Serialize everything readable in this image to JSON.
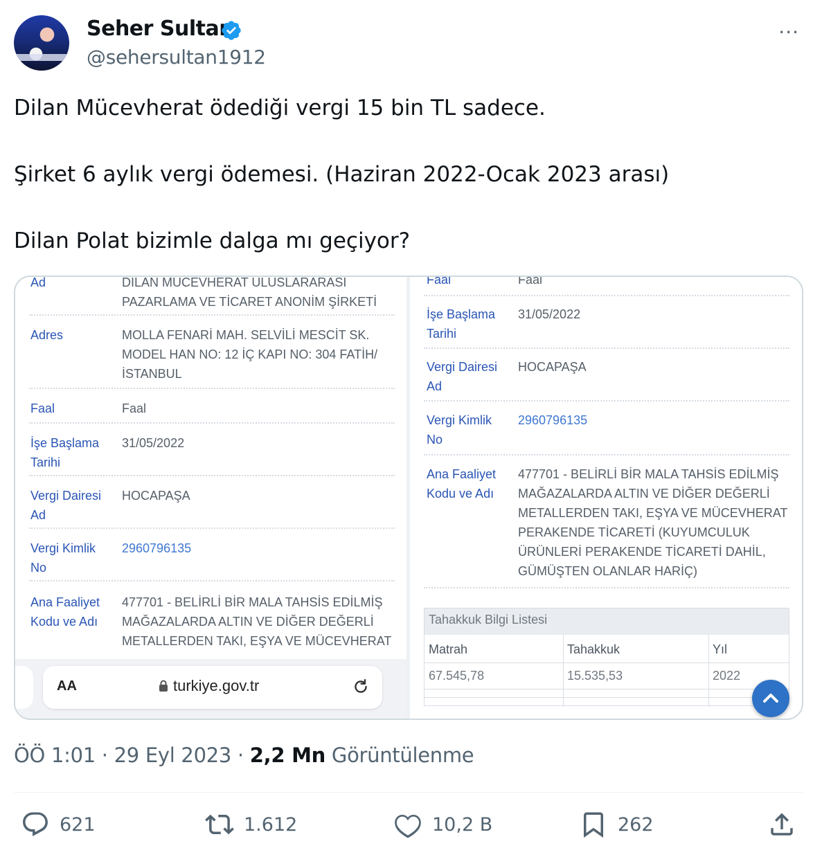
{
  "author": {
    "name": "Seher Sultan",
    "handle": "@sehersultan1912",
    "verified_icon": "verified-badge-icon"
  },
  "more_label": "···",
  "tweet": {
    "lines": [
      "Dilan Mücevherat ödediği vergi 15 bin TL sadece.",
      "Şirket 6 aylık vergi ödemesi. (Haziran 2022-Ocak 2023 arası)",
      "Dilan Polat bizimle dalga mı geçiyor?"
    ]
  },
  "media": {
    "left": {
      "rows": [
        {
          "label": "Ad",
          "value": "DILAN MUCEVHERAT ULUSLARARASI\nPAZARLAMA VE TİCARET ANONİM ŞİRKETİ"
        },
        {
          "label": "Adres",
          "value": "MOLLA FENARİ MAH. SELVİLİ MESCİT SK.\nMODEL HAN NO: 12 İÇ KAPI NO: 304 FATİH/\nİSTANBUL"
        },
        {
          "label": "Faal",
          "value": "Faal"
        },
        {
          "label": "İşe Başlama\nTarihi",
          "value": "31/05/2022"
        },
        {
          "label": "Vergi Dairesi\nAd",
          "value": "HOCAPAŞA"
        },
        {
          "label": "Vergi Kimlik\nNo",
          "value": "2960796135"
        },
        {
          "label": "Ana Faaliyet\nKodu ve Adı",
          "value": "477701 - BELİRLİ BİR MALA TAHSİS EDİLMİŞ\nMAĞAZALARDA ALTIN VE DİĞER DEĞERLİ\nMETALLERDEN TAKI, EŞYA VE MÜCEVHERAT"
        }
      ],
      "browser": {
        "aa": "AA",
        "url": "turkiye.gov.tr"
      }
    },
    "right": {
      "rows": [
        {
          "label": "Faal",
          "value": "Faal"
        },
        {
          "label": "İşe Başlama\nTarihi",
          "value": "31/05/2022"
        },
        {
          "label": "Vergi Dairesi\nAd",
          "value": "HOCAPAŞA"
        },
        {
          "label": "Vergi Kimlik\nNo",
          "value": "2960796135"
        },
        {
          "label": "Ana Faaliyet\nKodu ve Adı",
          "value": "477701 - BELİRLİ BİR MALA TAHSİS EDİLMİŞ\nMAĞAZALARDA ALTIN VE DİĞER DEĞERLİ\nMETALLERDEN TAKI, EŞYA VE MÜCEVHERAT\nPERAKENDE TİCARETİ (KUYUMCULUK\nÜRÜNLERİ PERAKENDE TİCARETİ DAHİL,\nGÜMÜŞTEN OLANLAR HARİÇ)"
        }
      ],
      "table": {
        "title": "Tahakkuk Bilgi Listesi",
        "headers": [
          "Matrah",
          "Tahakkuk",
          "Yıl"
        ],
        "row": [
          "67.545,78",
          "15.535,53",
          "2022"
        ]
      }
    }
  },
  "meta": {
    "time": "ÖÖ 1:01 · 29 Eyl 2023 · ",
    "views_count": "2,2 Mn",
    "views_label": " Görüntülenme"
  },
  "actions": {
    "reply": "621",
    "retweet": "1.612",
    "like": "10,2 B",
    "bookmark": "262"
  },
  "colors": {
    "text": "#0f1419",
    "secondary": "#536471",
    "verified": "#1d9bf0",
    "link_label": "#2a55b5"
  }
}
